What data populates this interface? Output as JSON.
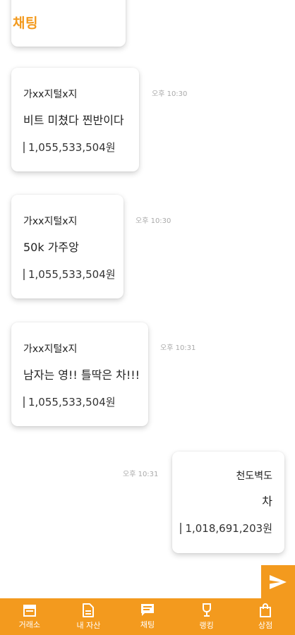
{
  "header": {
    "title": "채팅"
  },
  "messages": [
    {
      "sender": "가xx지털x지",
      "text": "비트 미쳤다 찐반이다",
      "assets": "1,055,533,504원",
      "time": "오후 10:30"
    },
    {
      "sender": "가xx지털x지",
      "text": "50k 가주앙",
      "assets": "1,055,533,504원",
      "time": "오후 10:30"
    },
    {
      "sender": "가xx지털x지",
      "text": "남자는 영!! 틀딱은 차!!!",
      "assets": "1,055,533,504원",
      "time": "오후 10:31"
    },
    {
      "sender": "천도벽도",
      "text": "차",
      "assets": "1,018,691,203원",
      "time": "오후 10:31"
    }
  ],
  "send": {
    "icon": "send-icon"
  },
  "tabs": [
    {
      "label": "거래소",
      "icon": "exchange-icon"
    },
    {
      "label": "내 자산",
      "icon": "document-icon"
    },
    {
      "label": "채팅",
      "icon": "chat-icon"
    },
    {
      "label": "랭킹",
      "icon": "trophy-icon"
    },
    {
      "label": "상점",
      "icon": "shopping-bag-icon"
    }
  ],
  "colors": {
    "accent": "#f39a1e",
    "time": "#aaaaaa"
  }
}
